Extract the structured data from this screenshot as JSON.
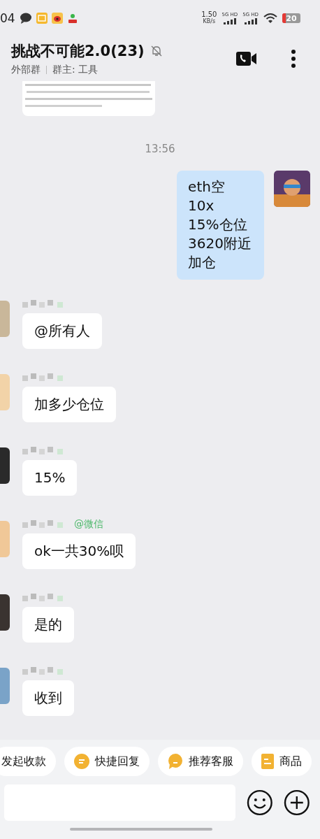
{
  "status_bar": {
    "time": "04",
    "speed": "1.50",
    "speed_unit": "KB/s",
    "networks": [
      "5G HD",
      "5G HD"
    ],
    "battery": "20"
  },
  "header": {
    "title": "挑战不可能2.0(23)",
    "muted": true,
    "group_type": "外部群",
    "owner": "群主: 工具"
  },
  "chat": {
    "timestamp": "13:56",
    "messages": [
      {
        "kind": "self",
        "lines": [
          "eth空",
          "10x",
          "15%仓位",
          "3620附近",
          "加仓"
        ]
      },
      {
        "kind": "other",
        "lines": [
          "@所有人"
        ]
      },
      {
        "kind": "other",
        "lines": [
          "加多少仓位"
        ]
      },
      {
        "kind": "other",
        "lines": [
          "15%"
        ]
      },
      {
        "kind": "other",
        "lines": [
          "ok一共30%呗"
        ],
        "sender_tag": "@微信"
      },
      {
        "kind": "other",
        "lines": [
          "是的"
        ]
      },
      {
        "kind": "other",
        "lines": [
          "收到"
        ]
      }
    ]
  },
  "quick_actions": [
    {
      "label": "发起收款",
      "kind": "plain"
    },
    {
      "label": "快捷回复",
      "kind": "reply"
    },
    {
      "label": "推荐客服",
      "kind": "service"
    },
    {
      "label": "商品",
      "kind": "goods"
    }
  ]
}
